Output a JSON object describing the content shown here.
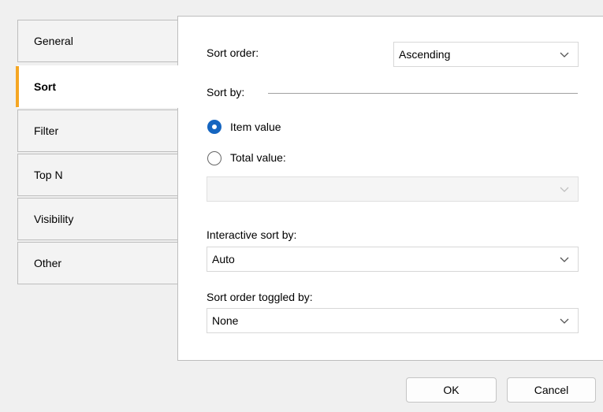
{
  "tabs": [
    {
      "label": "General"
    },
    {
      "label": "Sort",
      "active": true
    },
    {
      "label": "Filter"
    },
    {
      "label": "Top N"
    },
    {
      "label": "Visibility"
    },
    {
      "label": "Other"
    }
  ],
  "sort_order": {
    "label": "Sort order:",
    "value": "Ascending"
  },
  "sort_by": {
    "label": "Sort by:",
    "options": [
      {
        "label": "Item value",
        "selected": true
      },
      {
        "label": "Total value:",
        "selected": false
      }
    ],
    "total_value_select": ""
  },
  "interactive_sort": {
    "label": "Interactive sort by:",
    "value": "Auto"
  },
  "toggled_by": {
    "label": "Sort order toggled by:",
    "value": "None"
  },
  "buttons": {
    "ok": "OK",
    "cancel": "Cancel"
  },
  "colors": {
    "accent": "#f5a623",
    "radio_selected": "#1565c0"
  },
  "icons": {
    "dropdown": "chevron-down-icon"
  }
}
